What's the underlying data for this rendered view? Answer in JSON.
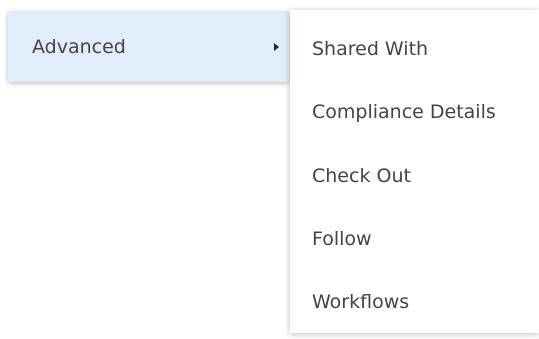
{
  "parent_menu": {
    "item": {
      "label": "Advanced",
      "icon": "chevron-right-icon"
    }
  },
  "submenu": {
    "items": [
      {
        "label": "Shared With"
      },
      {
        "label": "Compliance Details"
      },
      {
        "label": "Check Out"
      },
      {
        "label": "Follow"
      },
      {
        "label": "Workflows"
      }
    ]
  },
  "colors": {
    "highlight": "#dfeefa",
    "text": "#444444",
    "background": "#ffffff"
  }
}
